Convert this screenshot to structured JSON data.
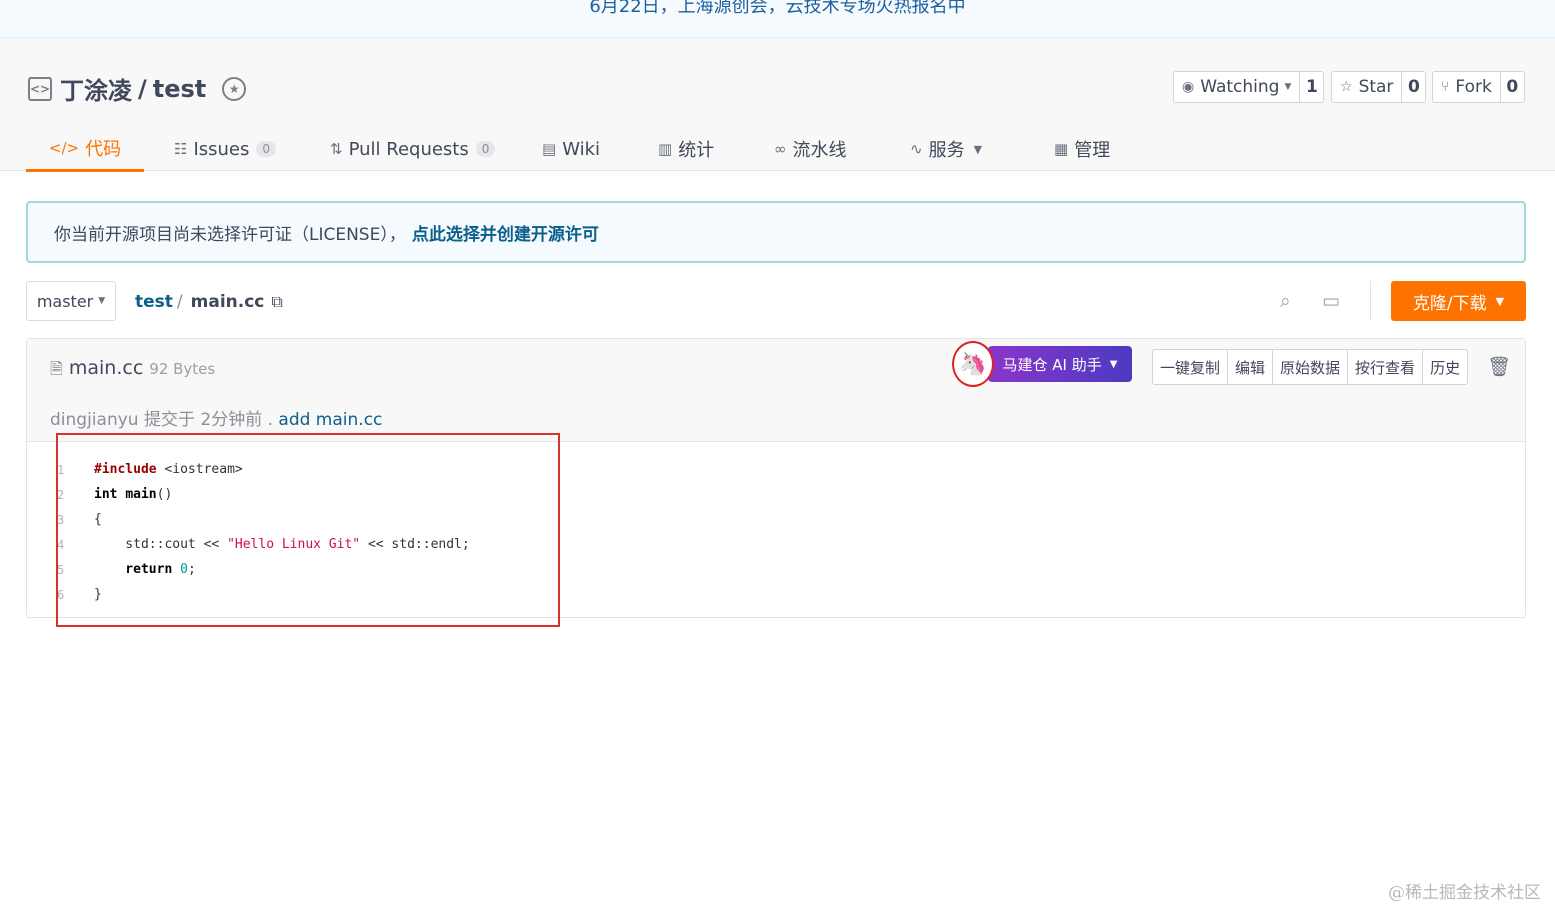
{
  "banner": {
    "text": "6月22日，上海源创会，云技术专场火热报名中"
  },
  "repo": {
    "owner": "丁涂凌",
    "separator": "/",
    "name": "test"
  },
  "social": {
    "watching_label": "Watching",
    "watching_count": "1",
    "star_label": "Star",
    "star_count": "0",
    "fork_label": "Fork",
    "fork_count": "0"
  },
  "tabs": {
    "code": "代码",
    "issues": "Issues",
    "issues_count": "0",
    "pulls": "Pull Requests",
    "pulls_count": "0",
    "wiki": "Wiki",
    "stats": "统计",
    "pipeline": "流水线",
    "services": "服务",
    "manage": "管理"
  },
  "license": {
    "text": "你当前开源项目尚未选择许可证（LICENSE），",
    "link": "点此选择并创建开源许可"
  },
  "branch": {
    "name": "master"
  },
  "breadcrumb": {
    "repo": "test",
    "sep": "/",
    "file": "main.cc"
  },
  "clone_button": "克隆/下载",
  "file": {
    "name": "main.cc",
    "size": "92 Bytes",
    "commit_author": "dingjianyu",
    "commit_time": "提交于 2分钟前 .",
    "commit_msg": "add main.cc"
  },
  "ai_button": "马建仓 AI 助手",
  "actions": {
    "copy": "一键复制",
    "edit": "编辑",
    "raw": "原始数据",
    "blame": "按行查看",
    "history": "历史"
  },
  "code": {
    "lines": [
      {
        "n": "1"
      },
      {
        "n": "2"
      },
      {
        "n": "3"
      },
      {
        "n": "4"
      },
      {
        "n": "5"
      },
      {
        "n": "6"
      }
    ],
    "l1_pp": "#include",
    "l1_rest": " <iostream>",
    "l2_kw": "int",
    "l2_fn": "main",
    "l2_rest": "()",
    "l3": "{",
    "l4_a": "    std::cout << ",
    "l4_str": "\"Hello Linux Git\"",
    "l4_b": " << std::endl;",
    "l5_kw": "    return",
    "l5_num": "0",
    "l5_end": ";",
    "l6": "}"
  },
  "watermark": "@稀土掘金技术社区",
  "icons": {
    "repo": "code-bracket-icon",
    "badge": "award-icon",
    "watch": "eye-icon",
    "star": "star-icon",
    "fork": "fork-icon",
    "search": "search-icon",
    "screen": "monitor-icon",
    "copy": "copy-icon",
    "file": "file-icon",
    "trash": "trash-icon"
  },
  "colors": {
    "accent": "#fe7300",
    "link": "#0b5f8c",
    "highlight": "#d9312b"
  }
}
